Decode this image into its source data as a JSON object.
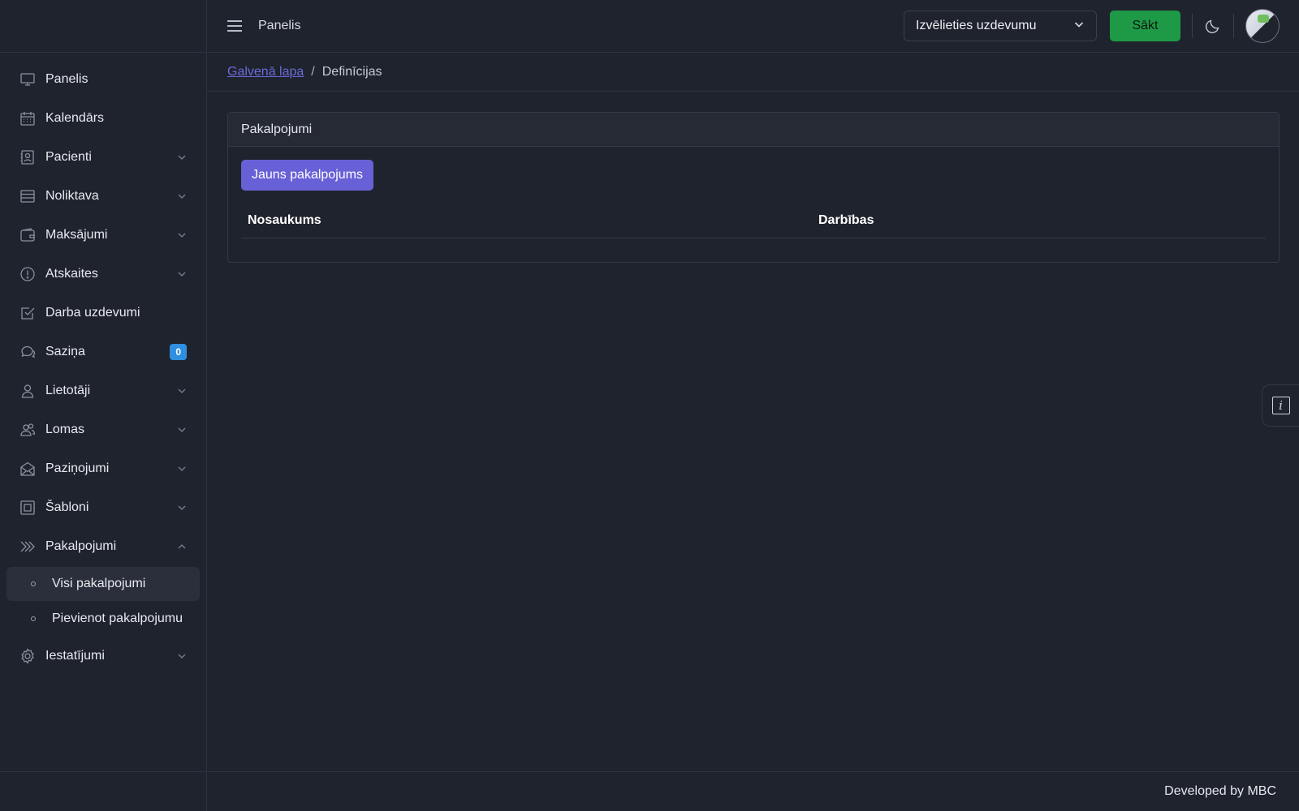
{
  "topbar": {
    "title": "Panelis",
    "task_select_value": "Izvēlieties uzdevumu",
    "start_label": "Sākt"
  },
  "breadcrumb": {
    "home": "Galvenā lapa",
    "separator": "/",
    "current": "Definīcijas"
  },
  "sidebar": {
    "items": [
      {
        "label": "Panelis",
        "icon": "monitor-icon"
      },
      {
        "label": "Kalendārs",
        "icon": "calendar-icon"
      },
      {
        "label": "Pacienti",
        "icon": "patient-card-icon"
      },
      {
        "label": "Noliktava",
        "icon": "storage-icon"
      },
      {
        "label": "Maksājumi",
        "icon": "wallet-icon"
      },
      {
        "label": "Atskaites",
        "icon": "alert-circle-icon"
      },
      {
        "label": "Darba uzdevumi",
        "icon": "checkbox-icon"
      },
      {
        "label": "Saziņa",
        "icon": "chat-icon",
        "badge": "0"
      },
      {
        "label": "Lietotāji",
        "icon": "user-icon"
      },
      {
        "label": "Lomas",
        "icon": "users-icon"
      },
      {
        "label": "Paziņojumi",
        "icon": "mail-open-icon"
      },
      {
        "label": "Šabloni",
        "icon": "template-icon"
      },
      {
        "label": "Pakalpojumi",
        "icon": "double-chevron-icon"
      },
      {
        "label": "Iestatījumi",
        "icon": "gear-icon"
      }
    ],
    "services_sub": [
      {
        "label": "Visi pakalpojumi"
      },
      {
        "label": "Pievienot pakalpojumu"
      }
    ]
  },
  "card": {
    "title": "Pakalpojumi",
    "new_button": "Jauns pakalpojums",
    "columns": [
      "Nosaukums",
      "Darbības"
    ]
  },
  "footer": {
    "text": "Developed by MBC"
  },
  "colors": {
    "accent": "#6860d6",
    "start_button": "#1e9a46",
    "badge": "#2f8fe0",
    "background": "#1f232d"
  }
}
